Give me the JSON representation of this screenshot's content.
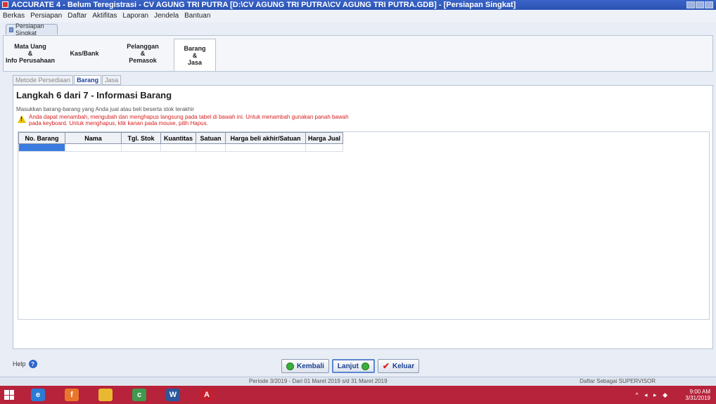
{
  "window": {
    "title": "ACCURATE 4 - Belum Teregistrasi - CV AGUNG TRI PUTRA  [D:\\CV AGUNG TRI PUTRA\\CV AGUNG TRI PUTRA.GDB] - [Persiapan Singkat]"
  },
  "menubar": [
    "Berkas",
    "Persiapan",
    "Daftar",
    "Aktifitas",
    "Laporan",
    "Jendela",
    "Bantuan"
  ],
  "doc_tab": "Persiapan Singkat",
  "wizard": {
    "steps": [
      {
        "label": "Mata Uang\n&\nInfo Perusahaan",
        "active": false
      },
      {
        "label": "Kas/Bank",
        "active": false
      },
      {
        "label": "Pelanggan\n&\nPemasok",
        "active": false
      },
      {
        "label": "Barang\n&\nJasa",
        "active": true
      }
    ]
  },
  "subtabs": [
    {
      "label": "Metode Persediaan",
      "active": false
    },
    {
      "label": "Barang",
      "active": true
    },
    {
      "label": "Jasa",
      "active": false
    }
  ],
  "main": {
    "step_title": "Langkah 6 dari 7  - Informasi Barang",
    "instruction": "Masukkan barang-barang yang Anda jual atau beli beserta stok terakhir",
    "warning": "Anda dapat menambah, mengubah dan menghapus langsung pada tabel di bawah ini. Untuk menambah gunakan panah bawah pada keyboard. Untuk menghapus, klik kanan pada mouse, pilih Hapus."
  },
  "grid": {
    "columns": [
      "No. Barang",
      "Nama",
      "Tgl. Stok",
      "Kuantitas",
      "Satuan",
      "Harga beli akhir/Satuan",
      "Harga Jual"
    ]
  },
  "help": {
    "label": "Help"
  },
  "buttons": {
    "back": "Kembali",
    "next": "Lanjut",
    "exit": "Keluar"
  },
  "status": {
    "period": "Periode 3/2019 - Dari 01 Maret 2019 s/d 31 Maret 2019",
    "user": "Daftar Sebagai SUPERVISOR"
  },
  "taskbar": {
    "apps": [
      {
        "icon": "edge-icon",
        "color": "#2a7bd6",
        "glyph": "e"
      },
      {
        "icon": "firefox-icon",
        "color": "#e8762b",
        "glyph": "f"
      },
      {
        "icon": "file-explorer-icon",
        "color": "#e8b930",
        "glyph": ""
      },
      {
        "icon": "chrome-icon",
        "color": "#3f9a4e",
        "glyph": "c"
      },
      {
        "icon": "word-icon",
        "color": "#2b579a",
        "glyph": "W"
      },
      {
        "icon": "accurate-icon",
        "color": "#c21f2f",
        "glyph": "A"
      }
    ],
    "time": "9:00 AM",
    "date": "3/31/2019"
  },
  "colors": {
    "titlebar": "#2a52b2",
    "taskbar": "#b6233a",
    "warning_text": "#d82020",
    "selected_cell": "#3a7be0"
  }
}
